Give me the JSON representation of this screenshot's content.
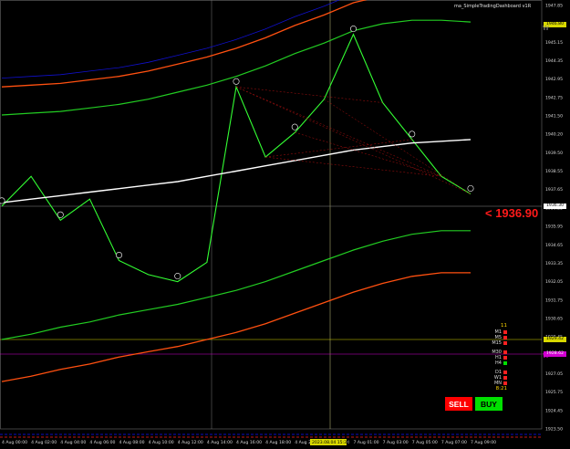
{
  "indicator_name": "ma_SimpleTradingDashboard v1R",
  "current_price_readout": "<  1936.90",
  "buttons": {
    "sell": "SELL",
    "buy": "BUY"
  },
  "price_axis": {
    "labels": [
      "1947.85",
      "1946.55",
      "1945.15",
      "1944.35",
      "1942.95",
      "1942.75",
      "1941.50",
      "1940.20",
      "1939.50",
      "1938.55",
      "1937.65",
      "1936.25",
      "1935.95",
      "1934.65",
      "1933.35",
      "1932.05",
      "1931.75",
      "1930.65",
      "1929.45",
      "1928.35",
      "1927.05",
      "1925.75",
      "1924.45",
      "1923.50"
    ],
    "tags": {
      "top_price": "1946.80",
      "current_price": "1936.30",
      "yellow_line": "1929.42",
      "magenta_line": "1928.62"
    }
  },
  "time_axis": {
    "labels": [
      "4 Aug 00:00",
      "4 Aug 02:00",
      "4 Aug 04:00",
      "4 Aug 06:00",
      "4 Aug 08:00",
      "4 Aug 10:00",
      "4 Aug 12:00",
      "4 Aug 14:00",
      "4 Aug 16:00",
      "4 Aug 18:00",
      "4 Aug 20:00",
      "4 Aug 22:00",
      "7 Aug 01:00",
      "7 Aug 03:00",
      "7 Aug 05:00",
      "7 Aug 07:00",
      "7 Aug 09:00"
    ],
    "highlight": "2023.08.04 15:30"
  },
  "timeframe_panel": {
    "count_label": "11",
    "rows": [
      {
        "label": "M1",
        "color": "#ff2020"
      },
      {
        "label": "M5",
        "color": "#ff2020"
      },
      {
        "label": "M15",
        "color": "#ff2020"
      },
      {
        "label": "M30",
        "color": "#ff2020"
      },
      {
        "label": "H1",
        "color": "#ff2020"
      },
      {
        "label": "H4",
        "color": "#00e000"
      },
      {
        "label": "D1",
        "color": "#ff2020"
      },
      {
        "label": "W1",
        "color": "#ff2020"
      },
      {
        "label": "MN",
        "color": "#ff2020"
      }
    ],
    "time_left": "8:21"
  },
  "markers": {
    "w_top": "W",
    "w_mid": "W"
  },
  "colors": {
    "price_line": "#33ff33",
    "ma_white": "#ffffff",
    "band_orange": "#ff5010",
    "band_green": "#22cc22",
    "blue_line": "#1010cc",
    "yellow_line": "#d8d800",
    "magenta_line": "#d000d0",
    "sell": "#ff0000",
    "buy": "#00e000"
  },
  "chart_data": {
    "type": "line",
    "x": [
      "4 Aug 00:00",
      "4 Aug 02:00",
      "4 Aug 04:00",
      "4 Aug 06:00",
      "4 Aug 08:00",
      "4 Aug 10:00",
      "4 Aug 12:00",
      "4 Aug 14:00",
      "4 Aug 16:00",
      "4 Aug 18:00",
      "4 Aug 20:00",
      "4 Aug 22:00",
      "7 Aug 01:00",
      "7 Aug 03:00",
      "7 Aug 05:00",
      "7 Aug 07:00",
      "7 Aug 09:00"
    ],
    "series": [
      {
        "name": "price",
        "values": [
          1936.2,
          1937.9,
          1935.4,
          1936.6,
          1933.1,
          1932.3,
          1931.9,
          1933.0,
          1943.0,
          1939.0,
          1940.4,
          1942.3,
          1946.0,
          1942.1,
          1940.0,
          1937.9,
          1936.9
        ]
      },
      {
        "name": "moving average",
        "values": [
          1936.4,
          1936.6,
          1936.8,
          1937.0,
          1937.2,
          1937.4,
          1937.6,
          1937.9,
          1938.2,
          1938.5,
          1938.8,
          1939.1,
          1939.4,
          1939.6,
          1939.8,
          1939.9,
          1940.0
        ]
      },
      {
        "name": "upper band",
        "values": [
          1941.4,
          1941.5,
          1941.6,
          1941.8,
          1942.0,
          1942.3,
          1942.7,
          1943.1,
          1943.6,
          1944.2,
          1944.9,
          1945.5,
          1946.2,
          1946.6,
          1946.8,
          1946.8,
          1946.7
        ]
      },
      {
        "name": "lower band",
        "values": [
          1928.6,
          1928.9,
          1929.3,
          1929.6,
          1930.0,
          1930.3,
          1930.6,
          1931.0,
          1931.4,
          1931.9,
          1932.5,
          1933.1,
          1933.7,
          1934.2,
          1934.6,
          1934.8,
          1934.8
        ]
      }
    ],
    "ylim": [
      1923.5,
      1947.85
    ]
  }
}
